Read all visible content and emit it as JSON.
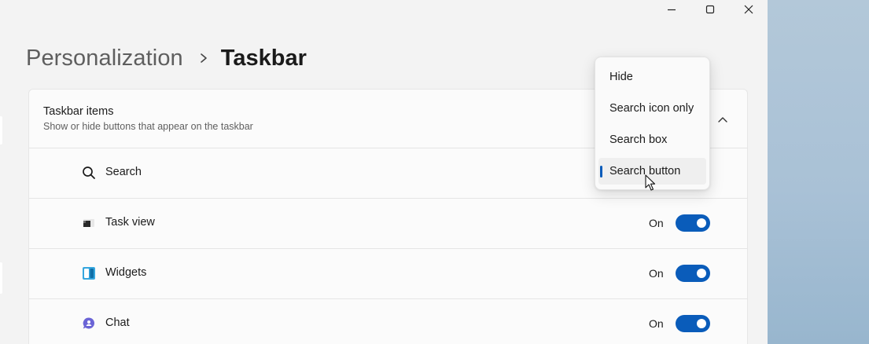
{
  "window": {
    "caption": {
      "minimize_icon": "minimize-icon",
      "maximize_icon": "maximize-icon",
      "close_icon": "close-icon"
    }
  },
  "breadcrumb": {
    "parent": "Personalization",
    "separator_icon": "chevron-right-icon",
    "current": "Taskbar"
  },
  "section": {
    "title": "Taskbar items",
    "subtitle": "Show or hide buttons that appear on the taskbar",
    "expand_icon": "chevron-up-icon",
    "expanded": true
  },
  "items": [
    {
      "label": "Search",
      "icon": "search-icon",
      "state": "",
      "toggle_on": null
    },
    {
      "label": "Task view",
      "icon": "task-view-icon",
      "state": "On",
      "toggle_on": true
    },
    {
      "label": "Widgets",
      "icon": "widgets-icon",
      "state": "On",
      "toggle_on": true
    },
    {
      "label": "Chat",
      "icon": "chat-icon",
      "state": "On",
      "toggle_on": true
    }
  ],
  "search_dropdown": {
    "options": [
      "Hide",
      "Search icon only",
      "Search box",
      "Search button"
    ],
    "selected": "Search button"
  },
  "colors": {
    "accent": "#0a5cba",
    "window_bg": "#f3f3f3",
    "card_bg": "#fbfbfb"
  }
}
